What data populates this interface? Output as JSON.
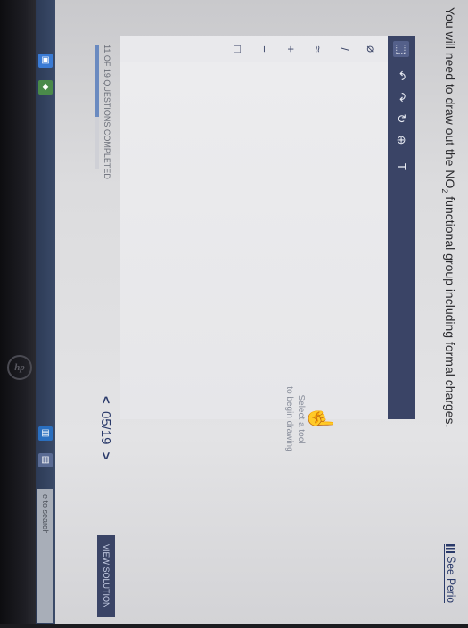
{
  "question": {
    "prefix": "You will need to draw out the NO",
    "subscript": "2",
    "suffix": " functional group including formal charges."
  },
  "periodic_link": "See Perio",
  "toolbar": {
    "items": [
      {
        "name": "select-tool",
        "glyph": "⬚"
      },
      {
        "name": "undo-icon",
        "glyph": "↶"
      },
      {
        "name": "redo-icon",
        "glyph": "↷"
      },
      {
        "name": "reset-icon",
        "glyph": "↻"
      },
      {
        "name": "zoom-icon",
        "glyph": "⊕"
      },
      {
        "name": "text-tool-icon",
        "glyph": "T"
      }
    ]
  },
  "left_tools": [
    {
      "name": "eraser-icon",
      "glyph": "⌀"
    },
    {
      "name": "single-bond-icon",
      "glyph": "/"
    },
    {
      "name": "chain-icon",
      "glyph": "≈"
    },
    {
      "name": "positive-charge-icon",
      "glyph": "+"
    },
    {
      "name": "negative-charge-icon",
      "glyph": "−"
    },
    {
      "name": "bracket-icon",
      "glyph": "□"
    }
  ],
  "hint": {
    "line1": "Select a tool",
    "line2": "to begin drawing"
  },
  "progress": {
    "label": "11 OF 19 QUESTIONS COMPLETED",
    "fraction": 0.58
  },
  "pager": {
    "current": "05",
    "total": "/19"
  },
  "view_solution": "VIEW SOLUTION",
  "taskbar": {
    "search_text": "e to search"
  },
  "colors": {
    "accent": "#3a4466",
    "link": "#2a3a6a"
  }
}
